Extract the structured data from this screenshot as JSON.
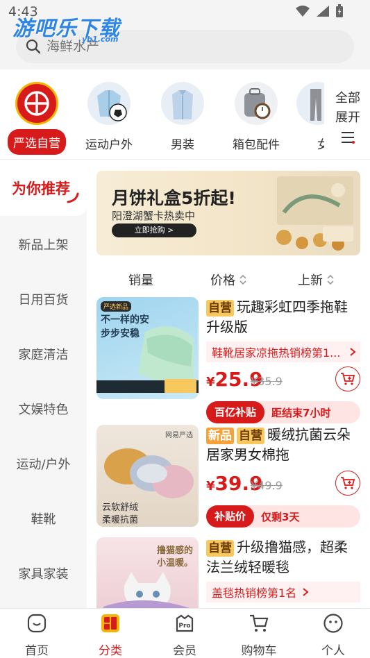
{
  "status": {
    "time": "4:43"
  },
  "watermark": {
    "brand": "游吧乐下载",
    "domain": "yb1.com"
  },
  "search": {
    "placeholder": "海鲜水产"
  },
  "categories": [
    {
      "label": "严选自营",
      "icon": "yanxuan-logo-icon",
      "active": true
    },
    {
      "label": "运动户外",
      "icon": "sports-jacket-ball-icon"
    },
    {
      "label": "男装",
      "icon": "shirt-icon"
    },
    {
      "label": "箱包配件",
      "icon": "bag-watch-icon"
    },
    {
      "label": "女",
      "icon": "pants-icon"
    }
  ],
  "expand": {
    "line1": "全部",
    "line2": "展开"
  },
  "leftnav": {
    "title": "为你推荐",
    "items": [
      "新品上架",
      "日用百货",
      "家庭清洁",
      "文娱特色",
      "运动/户外",
      "鞋靴",
      "家具家装"
    ]
  },
  "banner": {
    "title": "月饼礼盒5折起!",
    "subtitle": "阳澄湖蟹卡热卖中",
    "button": "立即抢购 >"
  },
  "sort": {
    "sales": "销量",
    "price": "价格",
    "new": "上新"
  },
  "products": [
    {
      "tags": [
        "自营"
      ],
      "title": "玩趣彩虹四季拖鞋升级版",
      "rank": "鞋靴居家凉拖热销榜第1...",
      "yen": "¥",
      "price": "25.9",
      "orig": "¥35.9",
      "promo_badge": "百亿补贴",
      "promo_text": "距结束7小时",
      "img_text_1": "严选新品",
      "img_text_2": "步步安稳",
      "img_text_3": "不一样的安心"
    },
    {
      "tags": [
        "新品",
        "自营"
      ],
      "title": "暖绒抗菌云朵居家男女棉拖",
      "yen": "¥",
      "price": "39.9",
      "orig": "¥49.9",
      "promo_badge": "补贴价",
      "promo_text": "仅剩3天",
      "img_text_1": "网易严选",
      "img_text_2": "云软舒绒",
      "img_text_3": "柔暖抗菌"
    },
    {
      "tags": [
        "自营"
      ],
      "title": "升级撸猫感，超柔法兰绒轻暖毯",
      "rank": "盖毯热销榜第1名",
      "img_text_1": "撸猫感的",
      "img_text_2": "小温暖。"
    }
  ],
  "bottom": {
    "home": "首页",
    "category": "分类",
    "member": "会员",
    "cart": "购物车",
    "profile": "个人"
  },
  "colors": {
    "accent": "#d71a1a",
    "yellow": "#f6b400"
  }
}
